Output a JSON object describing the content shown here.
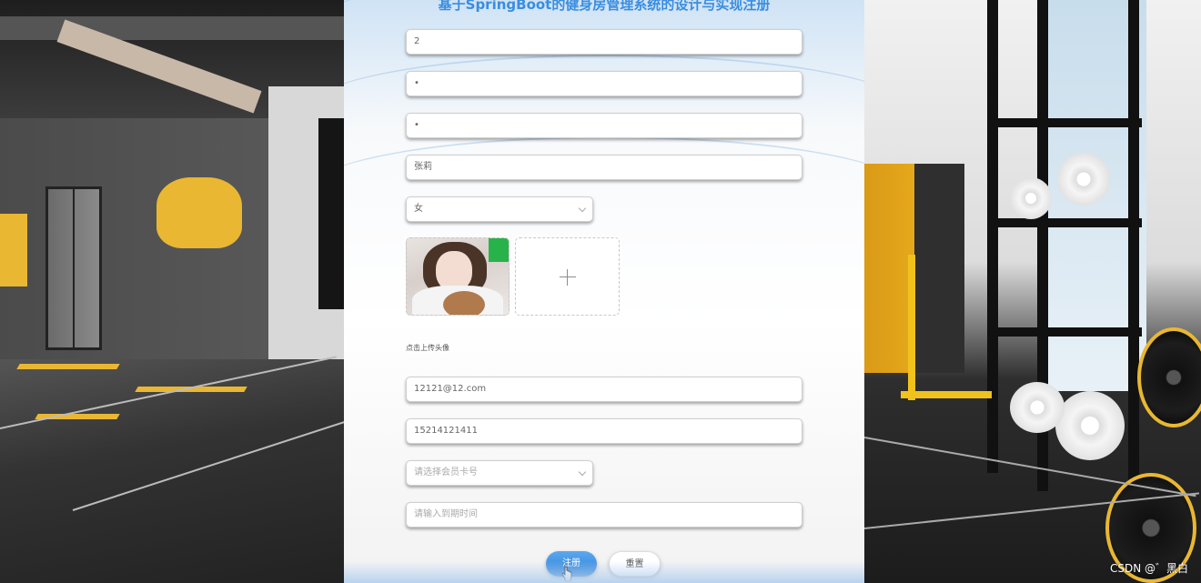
{
  "title": "基于SpringBoot的健身房管理系统的设计与实现注册",
  "form": {
    "account": "2",
    "password": "•",
    "confirm_password": "•",
    "name": "张莉",
    "gender": "女",
    "upload_label": "点击上传头像",
    "email": "12121@12.com",
    "phone": "15214121411",
    "member_card_placeholder": "请选择会员卡号",
    "expire_placeholder": "请输入到期时间"
  },
  "buttons": {
    "register": "注册",
    "reset": "重置"
  },
  "watermark": "CSDN @゛黑白",
  "colors": {
    "accent": "#3a8de0",
    "primary_button": "#2d7fd6"
  },
  "icons": [
    "plus-icon",
    "chevron-down-icon",
    "cursor-hand-icon"
  ]
}
